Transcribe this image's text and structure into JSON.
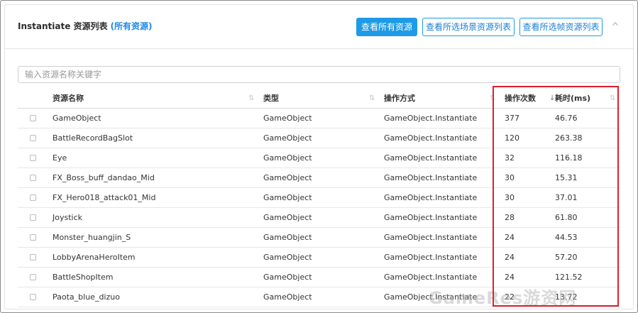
{
  "header": {
    "title": "Instantiate 资源列表",
    "subtitle": "(所有资源)",
    "buttons": {
      "all": "查看所有资源",
      "scene": "查看所选场景资源列表",
      "frame": "查看所选帧资源列表"
    }
  },
  "search": {
    "placeholder": "输入资源名称关键字",
    "value": ""
  },
  "table": {
    "columns": {
      "name": "资源名称",
      "type": "类型",
      "op": "操作方式",
      "count": "操作次数",
      "time": "耗时(ms)"
    },
    "sorted_by": "count",
    "rows": [
      {
        "name": "GameObject",
        "type": "GameObject",
        "op": "GameObject.Instantiate",
        "count": "377",
        "time": "46.76"
      },
      {
        "name": "BattleRecordBagSlot",
        "type": "GameObject",
        "op": "GameObject.Instantiate",
        "count": "120",
        "time": "263.38"
      },
      {
        "name": "Eye",
        "type": "GameObject",
        "op": "GameObject.Instantiate",
        "count": "32",
        "time": "116.18"
      },
      {
        "name": "FX_Boss_buff_dandao_Mid",
        "type": "GameObject",
        "op": "GameObject.Instantiate",
        "count": "30",
        "time": "15.31"
      },
      {
        "name": "FX_Hero018_attack01_Mid",
        "type": "GameObject",
        "op": "GameObject.Instantiate",
        "count": "30",
        "time": "37.01"
      },
      {
        "name": "Joystick",
        "type": "GameObject",
        "op": "GameObject.Instantiate",
        "count": "28",
        "time": "61.80"
      },
      {
        "name": "Monster_huangjin_S",
        "type": "GameObject",
        "op": "GameObject.Instantiate",
        "count": "24",
        "time": "44.53"
      },
      {
        "name": "LobbyArenaHeroItem",
        "type": "GameObject",
        "op": "GameObject.Instantiate",
        "count": "24",
        "time": "57.20"
      },
      {
        "name": "BattleShopItem",
        "type": "GameObject",
        "op": "GameObject.Instantiate",
        "count": "24",
        "time": "121.52"
      },
      {
        "name": "Paota_blue_dizuo",
        "type": "GameObject",
        "op": "GameObject.Instantiate",
        "count": "22",
        "time": "13.72"
      }
    ]
  },
  "icons": {
    "sort": "sort-icon",
    "sort_active": "sort-desc-icon",
    "collapse": "chevron-up-icon"
  },
  "colors": {
    "primary": "#1e9be6",
    "subtitle": "#1e88e5",
    "highlight": "#e0202c"
  },
  "watermark": "GameRes游资网"
}
